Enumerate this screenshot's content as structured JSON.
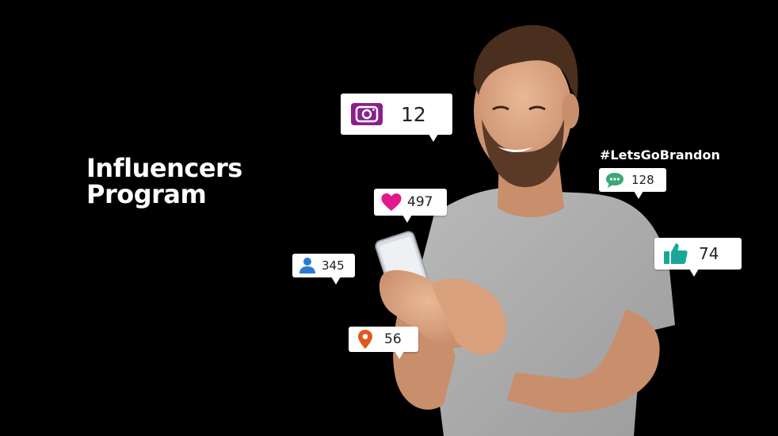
{
  "title": {
    "line1": "Influencers",
    "line2": "Program"
  },
  "hashtag": "#LetsGoBrandon",
  "stats": {
    "instagram": {
      "icon": "instagram-icon",
      "value": "12",
      "color": "#8a1f8f"
    },
    "likes": {
      "icon": "heart-icon",
      "value": "497",
      "color": "#e0198c"
    },
    "comments": {
      "icon": "comment-icon",
      "value": "128",
      "color": "#3aa876"
    },
    "followers": {
      "icon": "user-icon",
      "value": "345",
      "color": "#2a7bd0"
    },
    "thumbs": {
      "icon": "thumbs-up-icon",
      "value": "74",
      "color": "#1aa79a"
    },
    "location": {
      "icon": "location-pin-icon",
      "value": "56",
      "color": "#e0581f"
    }
  }
}
